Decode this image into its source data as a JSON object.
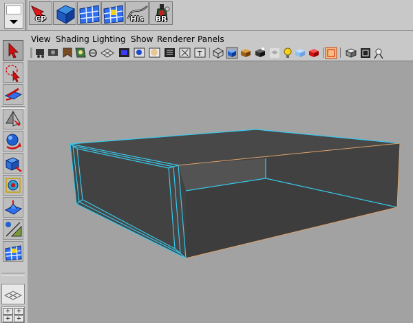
{
  "window": {
    "viewport_background": "#a2a2a2",
    "object_color": "#434343",
    "selection_color": "#37c8ec",
    "edge_color": "#e0a36a"
  },
  "shelf": {
    "buttons": [
      {
        "name": "cp-button",
        "label": "CP",
        "icon": "red-arrow-icon"
      },
      {
        "name": "cube-button",
        "label": "",
        "icon": "blue-cube-icon"
      },
      {
        "name": "grid-button-1",
        "label": "",
        "icon": "grid-icon"
      },
      {
        "name": "grid-button-2",
        "label": "",
        "icon": "grid-yellow-icon"
      },
      {
        "name": "his-button",
        "label": "His",
        "icon": "curve-icon"
      },
      {
        "name": "br-button",
        "label": "BR",
        "icon": "bottle-icon"
      }
    ]
  },
  "panel_menu": {
    "items": [
      "View",
      "Shading",
      "Lighting",
      "Show",
      "Renderer",
      "Panels"
    ]
  },
  "toolbox": {
    "tools": [
      "select-tool-icon",
      "lasso-tool-icon",
      "paint-select-tool-icon",
      "move-tool-icon",
      "rotate-tool-icon",
      "scale-tool-icon",
      "universal-manipulator-icon",
      "soft-modification-icon",
      "show-manipulator-icon",
      "last-tool-icon"
    ]
  }
}
